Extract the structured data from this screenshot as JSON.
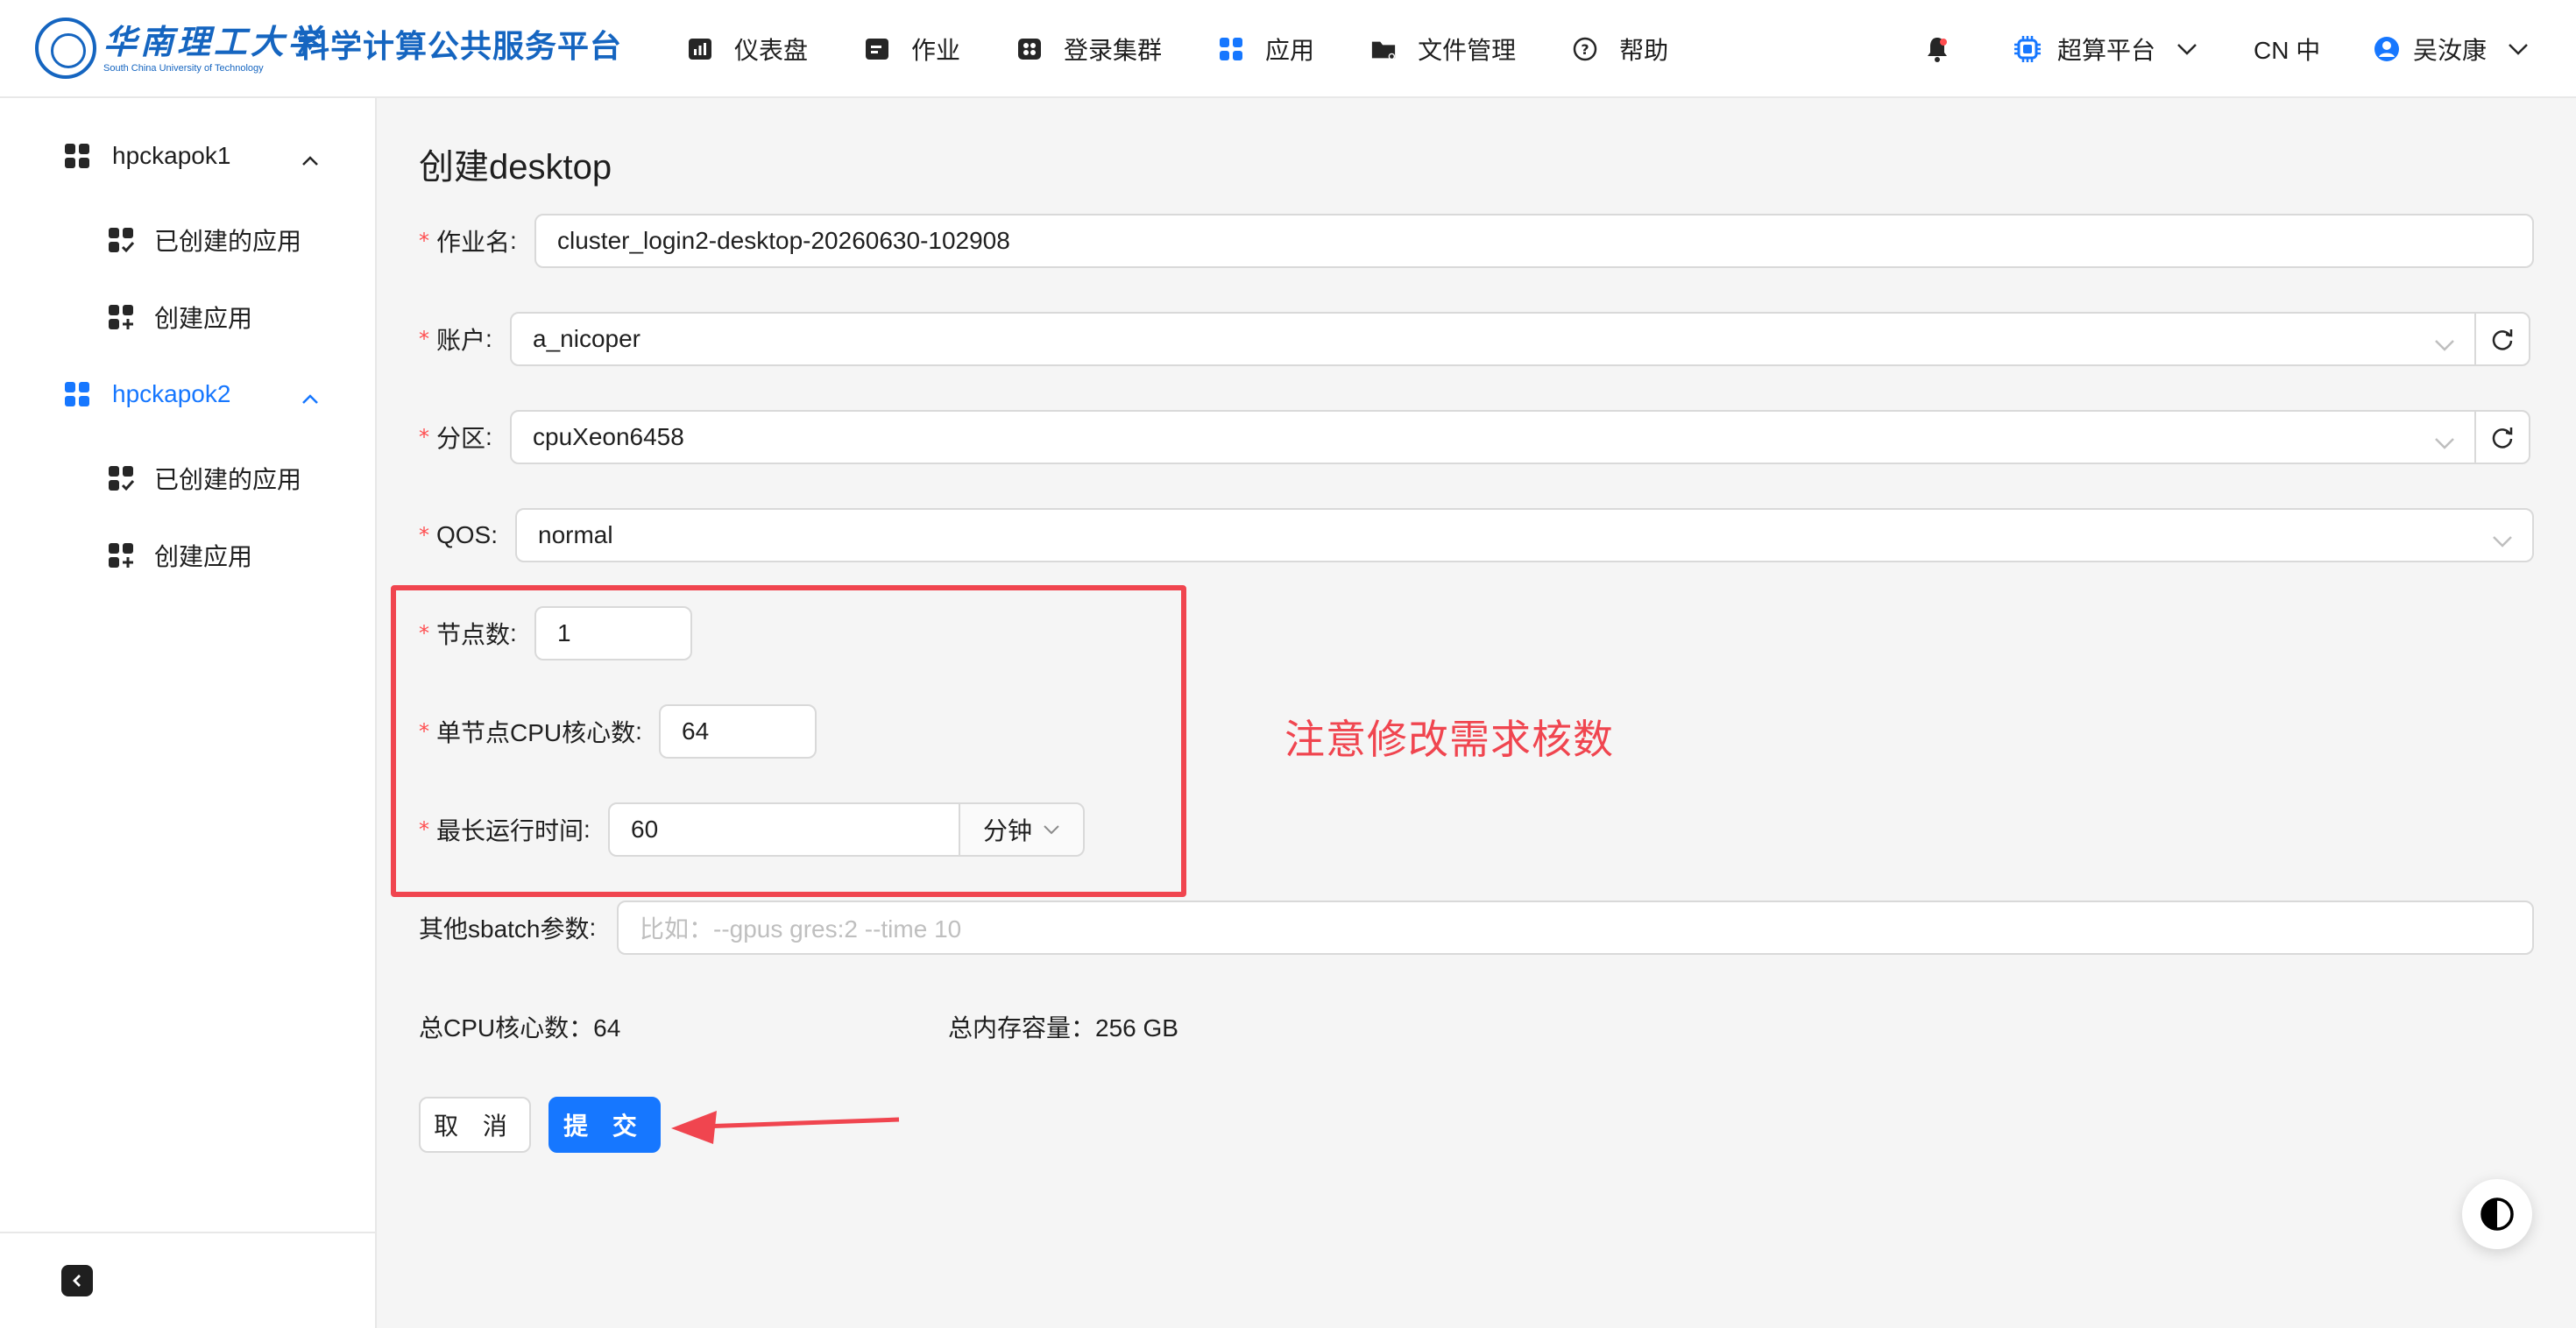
{
  "header": {
    "logo_cn": "华南理工大学",
    "logo_en": "South China University of Technology",
    "platform_title": "科学计算公共服务平台",
    "nav": [
      {
        "label": "仪表盘",
        "icon": "dashboard-icon"
      },
      {
        "label": "作业",
        "icon": "job-icon"
      },
      {
        "label": "登录集群",
        "icon": "cluster-icon"
      },
      {
        "label": "应用",
        "icon": "apps-icon"
      },
      {
        "label": "文件管理",
        "icon": "folder-icon"
      },
      {
        "label": "帮助",
        "icon": "help-icon"
      }
    ],
    "platform_selector": "超算平台",
    "language": "CN 中",
    "user_name": "吴汝康"
  },
  "sidebar": {
    "groups": [
      {
        "label": "hpckapok1",
        "items": [
          {
            "label": "已创建的应用",
            "icon": "created-apps-icon"
          },
          {
            "label": "创建应用",
            "icon": "create-app-icon"
          }
        ]
      },
      {
        "label": "hpckapok2",
        "items": [
          {
            "label": "已创建的应用",
            "icon": "created-apps-icon"
          },
          {
            "label": "创建应用",
            "icon": "create-app-icon"
          }
        ]
      }
    ]
  },
  "form": {
    "title": "创建desktop",
    "job_name": {
      "label": "作业名",
      "value": "cluster_login2-desktop-20260630-102908"
    },
    "account": {
      "label": "账户",
      "value": "a_nicoper"
    },
    "partition": {
      "label": "分区",
      "value": "cpuXeon6458"
    },
    "qos": {
      "label": "QOS",
      "value": "normal"
    },
    "nodes": {
      "label": "节点数",
      "value": "1"
    },
    "cpu_per_node": {
      "label": "单节点CPU核心数",
      "value": "64"
    },
    "max_runtime": {
      "label": "最长运行时间",
      "value": "60",
      "unit": "分钟"
    },
    "sbatch": {
      "label": "其他sbatch参数",
      "placeholder": "比如：--gpus gres:2 --time 10"
    },
    "total_cpu": "总CPU核心数：64",
    "total_mem": "总内存容量：256 GB",
    "cancel": "取 消",
    "submit": "提 交"
  },
  "annotation": {
    "note": "注意修改需求核数",
    "color": "#f0454f"
  },
  "colors": {
    "primary": "#1677ff",
    "brand": "#1565c0",
    "required": "#ff4d4f"
  }
}
